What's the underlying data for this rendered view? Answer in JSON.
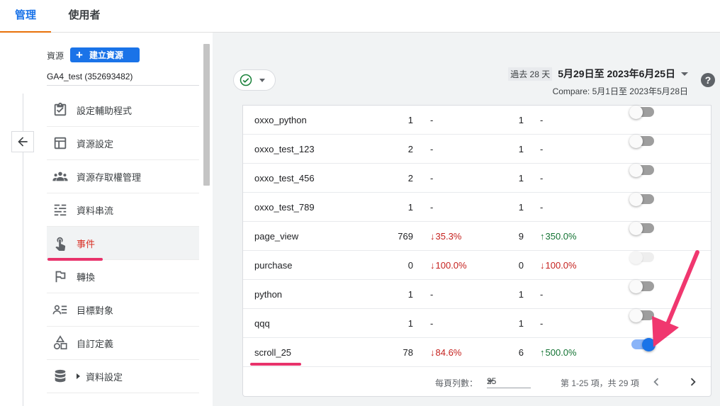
{
  "tabs": {
    "admin": "管理",
    "users": "使用者"
  },
  "sidebar": {
    "resource_label": "資源",
    "create_button": "建立資源",
    "property_name": "GA4_test (352693482)",
    "items": [
      {
        "label": "設定輔助程式",
        "icon": "clipboard-check-icon"
      },
      {
        "label": "資源設定",
        "icon": "layout-icon"
      },
      {
        "label": "資源存取權管理",
        "icon": "people-icon"
      },
      {
        "label": "資料串流",
        "icon": "data-stream-icon"
      },
      {
        "label": "事件",
        "icon": "touch-icon",
        "active": true
      },
      {
        "label": "轉換",
        "icon": "flag-icon"
      },
      {
        "label": "目標對象",
        "icon": "audience-icon"
      },
      {
        "label": "自訂定義",
        "icon": "shapes-icon"
      },
      {
        "label": "資料設定",
        "icon": "database-icon",
        "expandable": true
      }
    ]
  },
  "header": {
    "range_label": "過去 28 天",
    "date_range": "5月29日至 2023年6月25日",
    "compare": "Compare: 5月1日至 2023年5月28日"
  },
  "table": {
    "rows": [
      {
        "name": "oxxo_python",
        "count": "1",
        "count_change": "-",
        "count_dir": "none",
        "users": "1",
        "users_change": "-",
        "users_dir": "none",
        "toggle": "off"
      },
      {
        "name": "oxxo_test_123",
        "count": "2",
        "count_change": "-",
        "count_dir": "none",
        "users": "1",
        "users_change": "-",
        "users_dir": "none",
        "toggle": "off"
      },
      {
        "name": "oxxo_test_456",
        "count": "2",
        "count_change": "-",
        "count_dir": "none",
        "users": "1",
        "users_change": "-",
        "users_dir": "none",
        "toggle": "off"
      },
      {
        "name": "oxxo_test_789",
        "count": "1",
        "count_change": "-",
        "count_dir": "none",
        "users": "1",
        "users_change": "-",
        "users_dir": "none",
        "toggle": "off"
      },
      {
        "name": "page_view",
        "count": "769",
        "count_change": "35.3%",
        "count_dir": "down",
        "users": "9",
        "users_change": "350.0%",
        "users_dir": "up",
        "toggle": "off"
      },
      {
        "name": "purchase",
        "count": "0",
        "count_change": "100.0%",
        "count_dir": "down",
        "users": "0",
        "users_change": "100.0%",
        "users_dir": "down",
        "toggle": "disabled"
      },
      {
        "name": "python",
        "count": "1",
        "count_change": "-",
        "count_dir": "none",
        "users": "1",
        "users_change": "-",
        "users_dir": "none",
        "toggle": "off"
      },
      {
        "name": "qqq",
        "count": "1",
        "count_change": "-",
        "count_dir": "none",
        "users": "1",
        "users_change": "-",
        "users_dir": "none",
        "toggle": "off"
      },
      {
        "name": "scroll_25",
        "count": "78",
        "count_change": "84.6%",
        "count_dir": "down",
        "users": "6",
        "users_change": "500.0%",
        "users_dir": "up",
        "toggle": "on"
      }
    ]
  },
  "footer": {
    "rows_per_page_label": "每頁列數：",
    "rows_per_page": "25",
    "page_info": "第 1-25 項，共 29 項"
  },
  "colors": {
    "accent": "#1a73e8",
    "tab_indicator": "#e8710a",
    "active_nav": "#d93025",
    "highlight": "#e8336b",
    "down": "#c5221f",
    "up": "#137333"
  }
}
